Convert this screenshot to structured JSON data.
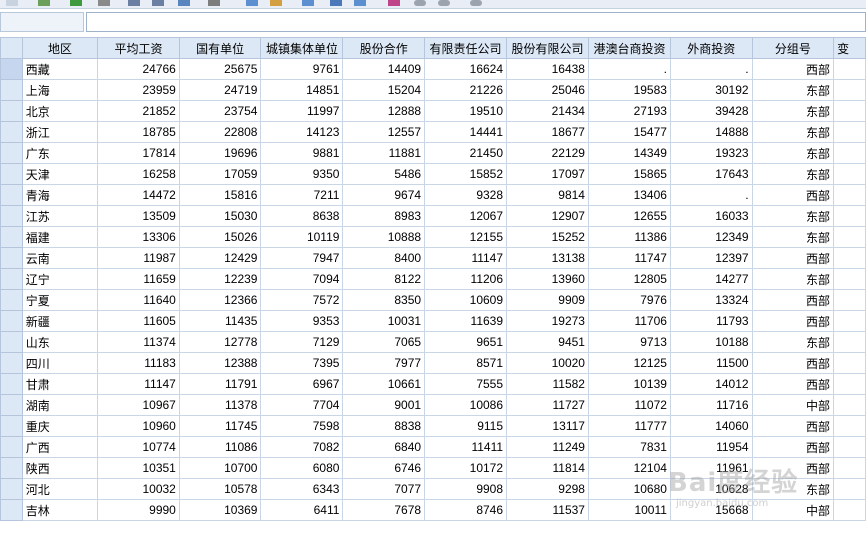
{
  "columns": [
    "地区",
    "平均工资",
    "国有单位",
    "城镇集体单位",
    "股份合作",
    "有限责任公司",
    "股份有限公司",
    "港澳台商投资",
    "外商投资",
    "分组号",
    "变"
  ],
  "rows": [
    [
      "西藏",
      "24766",
      "25675",
      "9761",
      "14409",
      "16624",
      "16438",
      ".",
      ".",
      "西部"
    ],
    [
      "上海",
      "23959",
      "24719",
      "14851",
      "15204",
      "21226",
      "25046",
      "19583",
      "30192",
      "东部"
    ],
    [
      "北京",
      "21852",
      "23754",
      "11997",
      "12888",
      "19510",
      "21434",
      "27193",
      "39428",
      "东部"
    ],
    [
      "浙江",
      "18785",
      "22808",
      "14123",
      "12557",
      "14441",
      "18677",
      "15477",
      "14888",
      "东部"
    ],
    [
      "广东",
      "17814",
      "19696",
      "9881",
      "11881",
      "21450",
      "22129",
      "14349",
      "19323",
      "东部"
    ],
    [
      "天津",
      "16258",
      "17059",
      "9350",
      "5486",
      "15852",
      "17097",
      "15865",
      "17643",
      "东部"
    ],
    [
      "青海",
      "14472",
      "15816",
      "7211",
      "9674",
      "9328",
      "9814",
      "13406",
      ".",
      "西部"
    ],
    [
      "江苏",
      "13509",
      "15030",
      "8638",
      "8983",
      "12067",
      "12907",
      "12655",
      "16033",
      "东部"
    ],
    [
      "福建",
      "13306",
      "15026",
      "10119",
      "10888",
      "12155",
      "15252",
      "11386",
      "12349",
      "东部"
    ],
    [
      "云南",
      "11987",
      "12429",
      "7947",
      "8400",
      "11147",
      "13138",
      "11747",
      "12397",
      "西部"
    ],
    [
      "辽宁",
      "11659",
      "12239",
      "7094",
      "8122",
      "11206",
      "13960",
      "12805",
      "14277",
      "东部"
    ],
    [
      "宁夏",
      "11640",
      "12366",
      "7572",
      "8350",
      "10609",
      "9909",
      "7976",
      "13324",
      "西部"
    ],
    [
      "新疆",
      "11605",
      "11435",
      "9353",
      "10031",
      "11639",
      "19273",
      "11706",
      "11793",
      "西部"
    ],
    [
      "山东",
      "11374",
      "12778",
      "7129",
      "7065",
      "9651",
      "9451",
      "9713",
      "10188",
      "东部"
    ],
    [
      "四川",
      "11183",
      "12388",
      "7395",
      "7977",
      "8571",
      "10020",
      "12125",
      "11500",
      "西部"
    ],
    [
      "甘肃",
      "11147",
      "11791",
      "6967",
      "10661",
      "7555",
      "11582",
      "10139",
      "14012",
      "西部"
    ],
    [
      "湖南",
      "10967",
      "11378",
      "7704",
      "9001",
      "10086",
      "11727",
      "11072",
      "11716",
      "中部"
    ],
    [
      "重庆",
      "10960",
      "11745",
      "7598",
      "8838",
      "9115",
      "13117",
      "11777",
      "14060",
      "西部"
    ],
    [
      "广西",
      "10774",
      "11086",
      "7082",
      "6840",
      "11411",
      "11249",
      "7831",
      "11954",
      "西部"
    ],
    [
      "陕西",
      "10351",
      "10700",
      "6080",
      "6746",
      "10172",
      "11814",
      "12104",
      "11961",
      "西部"
    ],
    [
      "河北",
      "10032",
      "10578",
      "6343",
      "7077",
      "9908",
      "9298",
      "10680",
      "10628",
      "东部"
    ],
    [
      "吉林",
      "9990",
      "10369",
      "6411",
      "7678",
      "8746",
      "11537",
      "10011",
      "15668",
      "中部"
    ]
  ],
  "watermark": "Bai度经验",
  "watermark_sub": "jingyan.baidu.com"
}
